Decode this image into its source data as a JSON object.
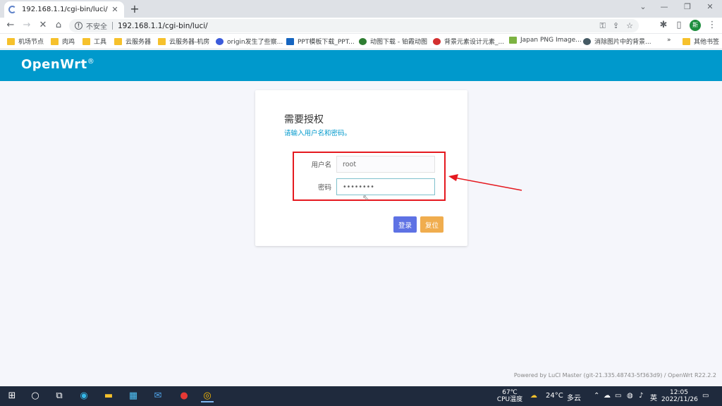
{
  "browser": {
    "tab_title": "192.168.1.1/cgi-bin/luci/",
    "insecure_label": "不安全",
    "url": "192.168.1.1/cgi-bin/luci/",
    "avatar_letter": "斯",
    "bookmarks": [
      {
        "label": "机场节点",
        "type": "folder"
      },
      {
        "label": "肉鸡",
        "type": "folder"
      },
      {
        "label": "工具",
        "type": "folder"
      },
      {
        "label": "云服务器",
        "type": "folder"
      },
      {
        "label": "云服务器-机房",
        "type": "folder"
      },
      {
        "label": "origin发生了些察...",
        "type": "site",
        "color": "#3b5bdb"
      },
      {
        "label": "PPT模板下载_PPT...",
        "type": "site",
        "color": "#1565c0"
      },
      {
        "label": "动图下载 - 铂霞动图",
        "type": "site",
        "color": "#2e7d32"
      },
      {
        "label": "背景元素设计元素_...",
        "type": "site",
        "color": "#d32f2f"
      },
      {
        "label": "Japan PNG Image...",
        "type": "site",
        "color": "#7cb342"
      },
      {
        "label": "消除图片中的背景...",
        "type": "site",
        "color": "#455a64"
      },
      {
        "label": "»",
        "type": "more"
      },
      {
        "label": "其他书签",
        "type": "folder"
      }
    ]
  },
  "app": {
    "brand": "OpenWrt",
    "brand_mark": "®"
  },
  "login": {
    "title": "需要授权",
    "hint": "请输入用户名和密码。",
    "username_label": "用户名",
    "username_value": "root",
    "password_label": "密码",
    "password_value": "••••••••",
    "login_button": "登录",
    "reset_button": "复位"
  },
  "footer": {
    "credit": "Powered by LuCI Master (git-21.335.48743-5f363d9) / OpenWrt R22.2.2"
  },
  "taskbar": {
    "cpu_temp": "67℃",
    "cpu_label": "CPU温度",
    "weather_temp": "24°C",
    "weather_desc": "多云",
    "ime": "英",
    "time": "12:05",
    "date": "2022/11/26"
  }
}
